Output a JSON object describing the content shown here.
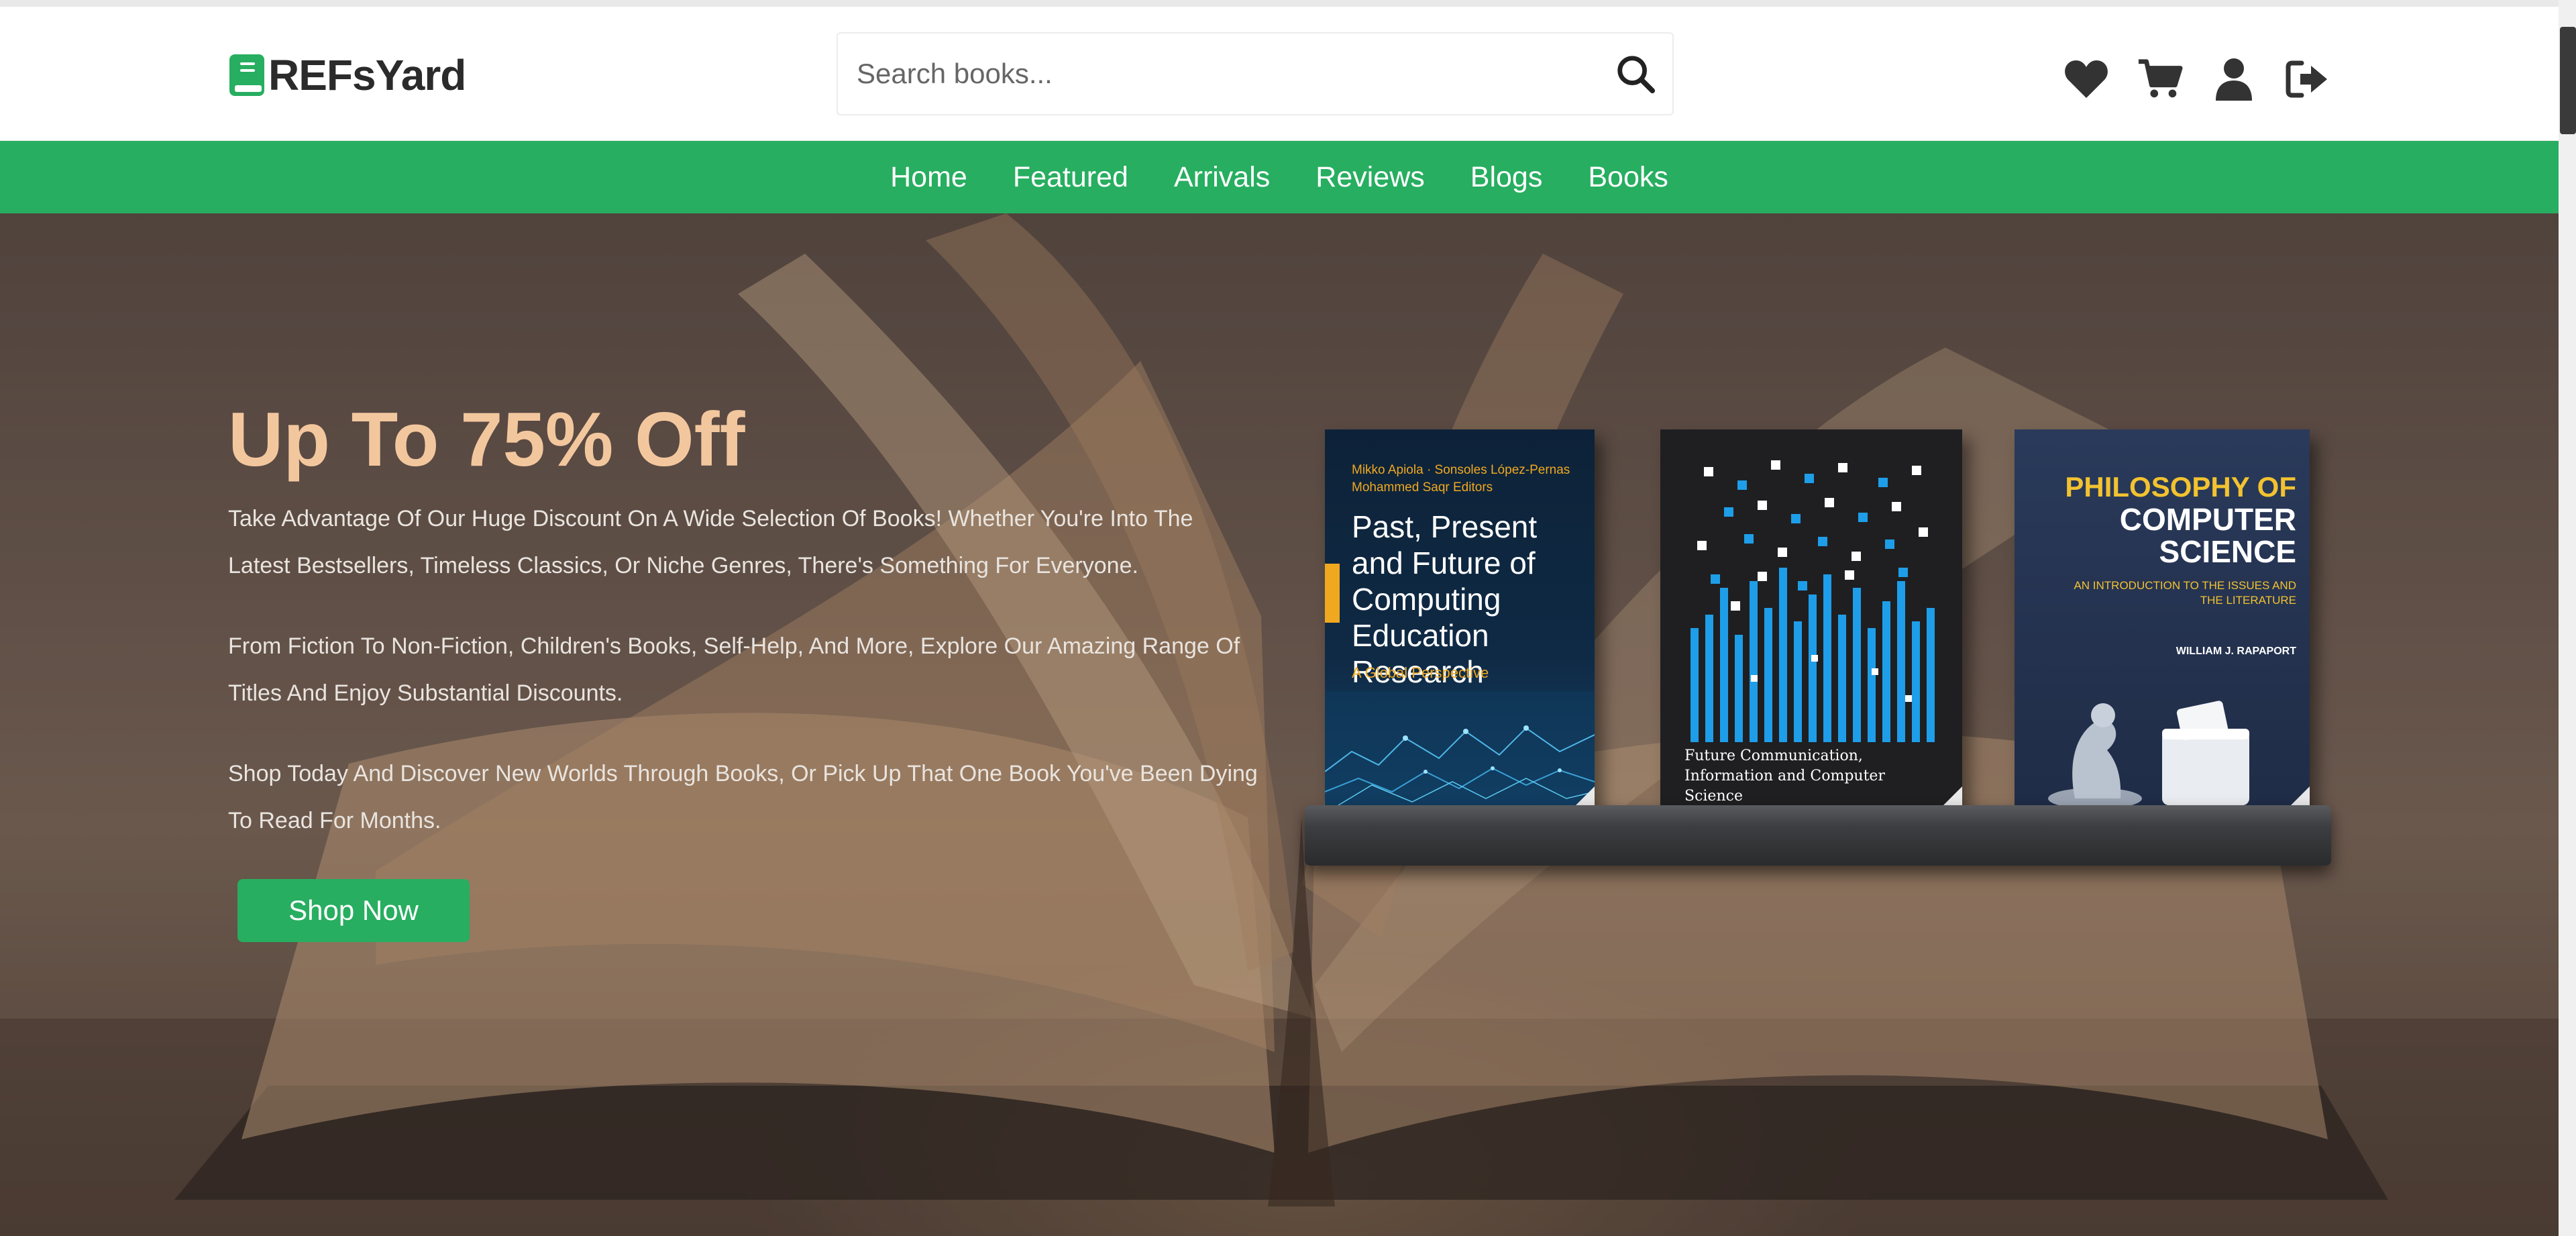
{
  "header": {
    "logo_text": "REFsYard",
    "search": {
      "placeholder": "Search books...",
      "value": ""
    },
    "icons": [
      "heart-icon",
      "cart-icon",
      "user-icon",
      "sign-out-icon"
    ]
  },
  "nav": {
    "items": [
      {
        "label": "Home"
      },
      {
        "label": "Featured"
      },
      {
        "label": "Arrivals"
      },
      {
        "label": "Reviews"
      },
      {
        "label": "Blogs"
      },
      {
        "label": "Books"
      }
    ]
  },
  "hero": {
    "title": "Up To 75% Off",
    "paragraphs": [
      "Take Advantage Of Our Huge Discount On A Wide Selection Of Books! Whether You're Into The Latest Bestsellers, Timeless Classics, Or Niche Genres, There's Something For Everyone.",
      "From Fiction To Non-Fiction, Children's Books, Self-Help, And More, Explore Our Amazing Range Of Titles And Enjoy Substantial Discounts.",
      "Shop Today And Discover New Worlds Through Books, Or Pick Up That One Book You've Been Dying To Read For Months."
    ],
    "cta_label": "Shop Now"
  },
  "books": [
    {
      "authors": "Mikko Apiola · Sonsoles López-Pernas Mohammed Saqr  Editors",
      "title": "Past, Present and Future of Computing Education Research",
      "subtitle": "A Global Perspective"
    },
    {
      "title": "Future Communication, Information and Computer Science"
    },
    {
      "title_line1": "PHILOSOPHY OF",
      "title_line2": "COMPUTER SCIENCE",
      "subtitle": "AN INTRODUCTION TO THE ISSUES AND THE LITERATURE",
      "author": "WILLIAM J. RAPAPORT"
    }
  ],
  "colors": {
    "brand_green": "#27ae60",
    "hero_title": "#f3c79e",
    "text_dark": "#2b2b2b"
  }
}
